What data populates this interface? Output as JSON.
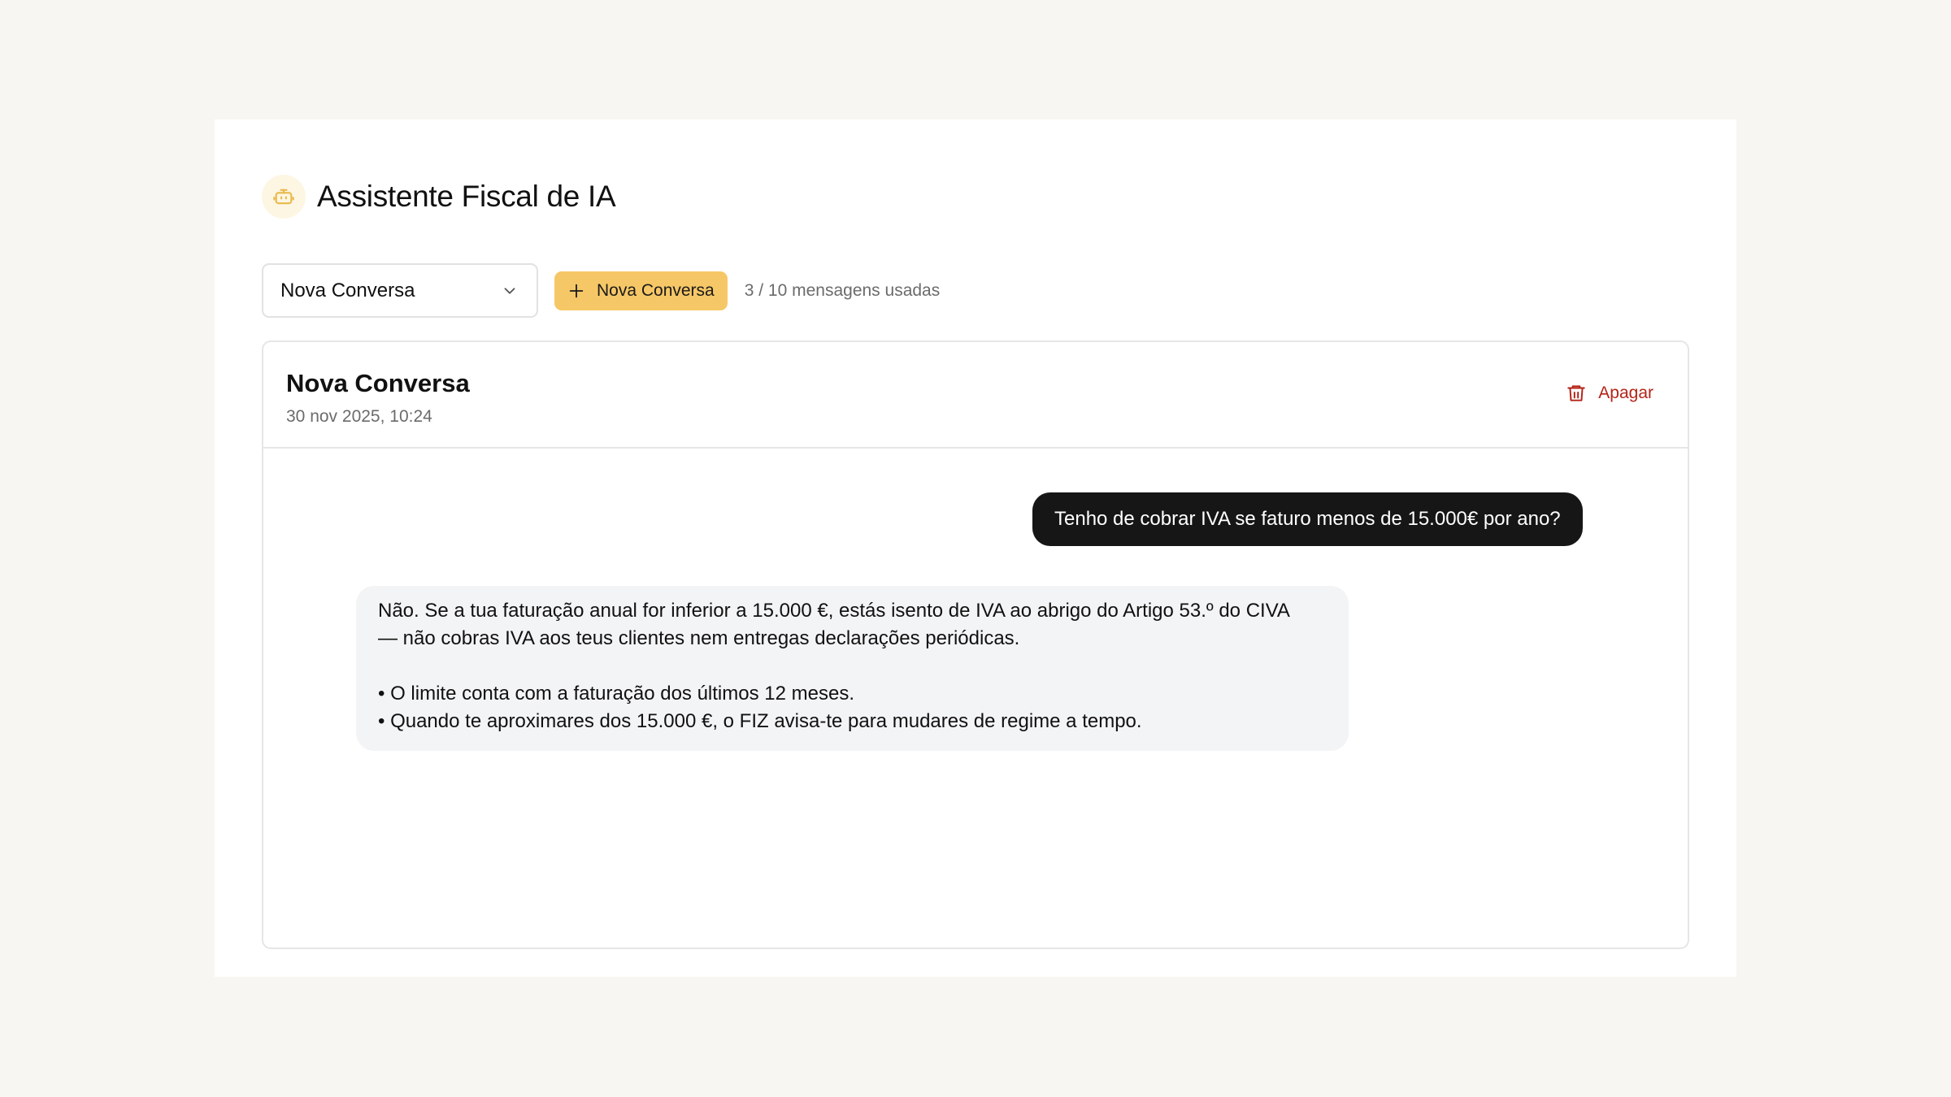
{
  "app": {
    "title": "Assistente Fiscal de IA",
    "icon": "robot-icon",
    "accent_color": "#f6c766"
  },
  "toolbar": {
    "conversation_select_value": "Nova Conversa",
    "new_conversation_label": "Nova Conversa",
    "usage_text": "3 / 10 mensagens usadas"
  },
  "conversation": {
    "title": "Nova Conversa",
    "date": "30 nov 2025, 10:24",
    "delete_label": "Apagar",
    "messages": [
      {
        "role": "user",
        "text": "Tenho de cobrar IVA se faturo menos de 15.000€ por ano?"
      },
      {
        "role": "assistant",
        "lines": [
          "Não. Se a tua faturação anual for inferior a 15.000 €, estás isento de IVA ao abrigo do Artigo 53.º do CIVA",
          "— não cobras IVA aos teus clientes nem entregas declarações periódicas.",
          "• O limite conta com a faturação dos últimos 12 meses.",
          "• Quando te aproximares dos 15.000 €, o FIZ avisa-te para mudares de regime a tempo."
        ]
      }
    ]
  }
}
